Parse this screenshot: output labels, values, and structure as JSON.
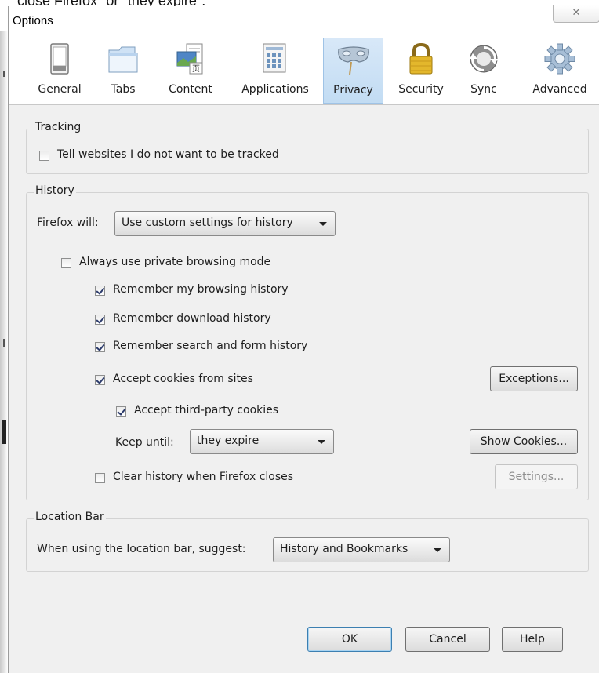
{
  "background_text": "close Firefox\" or \"they expire\".",
  "window": {
    "title": "Options",
    "close_glyph": "✕"
  },
  "tabs": [
    {
      "label": "General",
      "icon": "general-switch-icon"
    },
    {
      "label": "Tabs",
      "icon": "tabs-icon"
    },
    {
      "label": "Content",
      "icon": "content-icon"
    },
    {
      "label": "Applications",
      "icon": "applications-icon"
    },
    {
      "label": "Privacy",
      "icon": "privacy-mask-icon",
      "selected": true
    },
    {
      "label": "Security",
      "icon": "padlock-icon"
    },
    {
      "label": "Sync",
      "icon": "sync-icon"
    },
    {
      "label": "Advanced",
      "icon": "gear-icon"
    }
  ],
  "tracking": {
    "legend": "Tracking",
    "do_not_track_label": "Tell websites I do not want to be tracked",
    "do_not_track_checked": false
  },
  "history": {
    "legend": "History",
    "firefox_will_label": "Firefox will:",
    "firefox_will_value": "Use custom settings for history",
    "private_mode_label": "Always use private browsing mode",
    "private_mode_checked": false,
    "remember_browsing_label": "Remember my browsing history",
    "remember_browsing_checked": true,
    "remember_download_label": "Remember download history",
    "remember_download_checked": true,
    "remember_search_label": "Remember search and form history",
    "remember_search_checked": true,
    "accept_cookies_label": "Accept cookies from sites",
    "accept_cookies_checked": true,
    "exceptions_label": "Exceptions...",
    "third_party_label": "Accept third-party cookies",
    "third_party_checked": true,
    "keep_until_label": "Keep until:",
    "keep_until_value": "they expire",
    "show_cookies_label": "Show Cookies...",
    "clear_history_label": "Clear history when Firefox closes",
    "clear_history_checked": false,
    "settings_label": "Settings..."
  },
  "location_bar": {
    "legend": "Location Bar",
    "suggest_label": "When using the location bar, suggest:",
    "suggest_value": "History and Bookmarks"
  },
  "buttons": {
    "ok": "OK",
    "cancel": "Cancel",
    "help": "Help"
  },
  "colors": {
    "selected_tab": "#c8dff5",
    "dialog_bg": "#f0f0f0",
    "checkmark": "#2b3a6b"
  }
}
